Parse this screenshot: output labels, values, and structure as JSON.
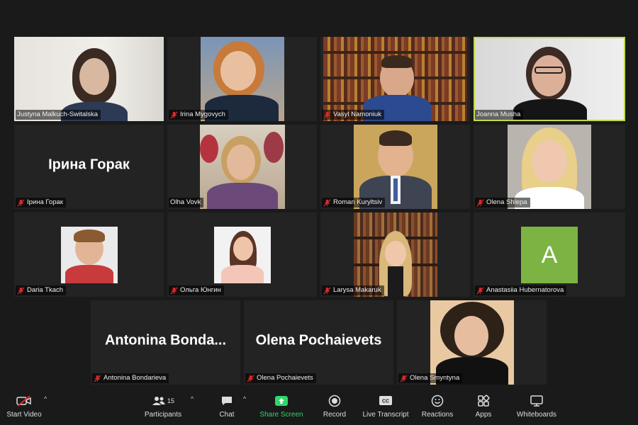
{
  "participants": [
    {
      "name": "Justyna Malkuch-Switalska",
      "muted": false
    },
    {
      "name": "Irina Mygovych",
      "muted": true
    },
    {
      "name": "Vasyl Namoniuk",
      "muted": true
    },
    {
      "name": "Joanna Musha",
      "muted": false,
      "active_speaker": true
    },
    {
      "name": "Ірина Горак",
      "muted": true,
      "display_name": "Ірина Горак"
    },
    {
      "name": "Olha Vovk",
      "muted": false
    },
    {
      "name": "Roman Kuryltsiv",
      "muted": true
    },
    {
      "name": "Olena Shlepa",
      "muted": true
    },
    {
      "name": "Daria Tkach",
      "muted": true
    },
    {
      "name": "Ольга Юнгин",
      "muted": true
    },
    {
      "name": "Larysa Makaruk",
      "muted": true
    },
    {
      "name": "Anastasiia Hubernatorova",
      "muted": true,
      "avatar_letter": "A"
    },
    {
      "name": "Antonina Bondarieva",
      "muted": true,
      "display_name": "Antonina  Bonda..."
    },
    {
      "name": "Olena Pochaievets",
      "muted": true,
      "display_name": "Olena Pochaievets"
    },
    {
      "name": "Olena Smyntyna",
      "muted": true
    }
  ],
  "toolbar": {
    "start_video": "Start Video",
    "participants": "Participants",
    "participants_count": "15",
    "chat": "Chat",
    "share_screen": "Share Screen",
    "record": "Record",
    "live_transcript": "Live Transcript",
    "reactions": "Reactions",
    "apps": "Apps",
    "whiteboards": "Whiteboards"
  },
  "colors": {
    "background": "#1a1a1a",
    "tile": "#232323",
    "active_speaker_border": "#c3d94a",
    "share_screen_green": "#2ed76a",
    "avatar_green": "#7cb342",
    "mic_muted_red": "#e02828"
  }
}
